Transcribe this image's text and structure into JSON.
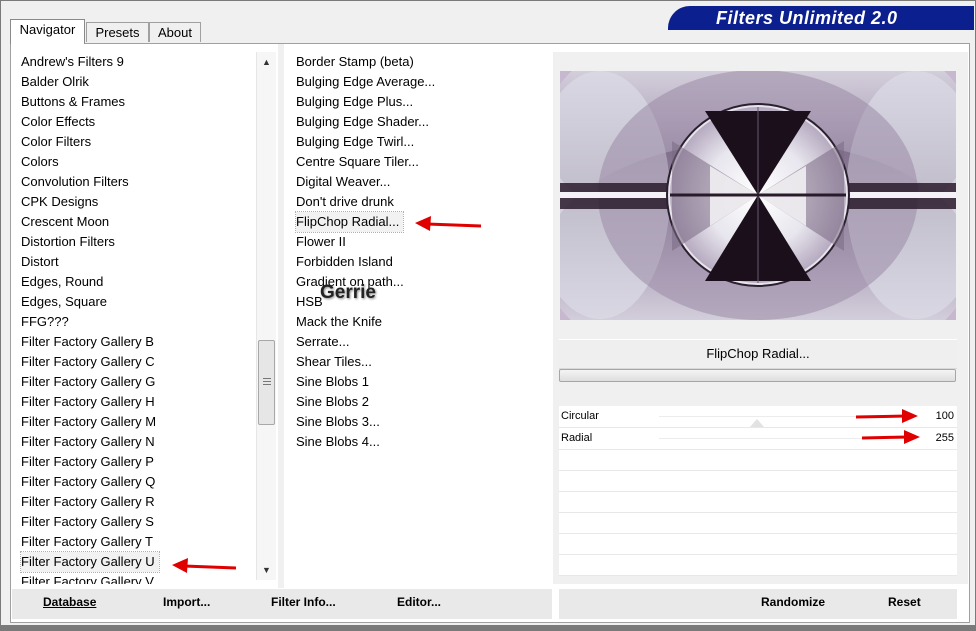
{
  "brand": {
    "title": "Filters Unlimited 2.0"
  },
  "tabs": [
    {
      "label": "Navigator",
      "active": true
    },
    {
      "label": "Presets",
      "active": false
    },
    {
      "label": "About",
      "active": false
    }
  ],
  "categories": {
    "selected": "Filter Factory Gallery U",
    "items": [
      "Andrew's Filters 9",
      "Balder Olrik",
      "Buttons & Frames",
      "Color Effects",
      "Color Filters",
      "Colors",
      "Convolution Filters",
      "CPK Designs",
      "Crescent Moon",
      "Distortion Filters",
      "Distort",
      "Edges, Round",
      "Edges, Square",
      "FFG???",
      "Filter Factory Gallery B",
      "Filter Factory Gallery C",
      "Filter Factory Gallery G",
      "Filter Factory Gallery H",
      "Filter Factory Gallery M",
      "Filter Factory Gallery N",
      "Filter Factory Gallery P",
      "Filter Factory Gallery Q",
      "Filter Factory Gallery R",
      "Filter Factory Gallery S",
      "Filter Factory Gallery T",
      "Filter Factory Gallery U",
      "Filter Factory Gallery V"
    ]
  },
  "filters": {
    "selected": "FlipChop Radial...",
    "items": [
      "Border Stamp (beta)",
      "Bulging Edge Average...",
      "Bulging Edge Plus...",
      "Bulging Edge Shader...",
      "Bulging Edge Twirl...",
      "Centre Square Tiler...",
      "Digital Weaver...",
      "Don't drive drunk",
      "FlipChop Radial...",
      "Flower II",
      "Forbidden Island",
      "Gradient on path...",
      "HSB",
      "Mack the Knife",
      "Serrate...",
      "Shear Tiles...",
      "Sine Blobs 1",
      "Sine Blobs 2",
      "Sine Blobs 3...",
      "Sine Blobs 4..."
    ]
  },
  "watermark": "Gerrie",
  "preview": {
    "filter_name": "FlipChop Radial..."
  },
  "sliders": [
    {
      "label": "Circular",
      "value": "100",
      "fraction": 0.39
    },
    {
      "label": "Radial",
      "value": "255",
      "fraction": 1.0
    }
  ],
  "buttons": {
    "database": "Database",
    "import": "Import...",
    "filter_info": "Filter Info...",
    "editor": "Editor...",
    "randomize": "Randomize",
    "reset": "Reset"
  },
  "colors": {
    "brand": "#0b1f8f",
    "arrow": "#e00000"
  }
}
